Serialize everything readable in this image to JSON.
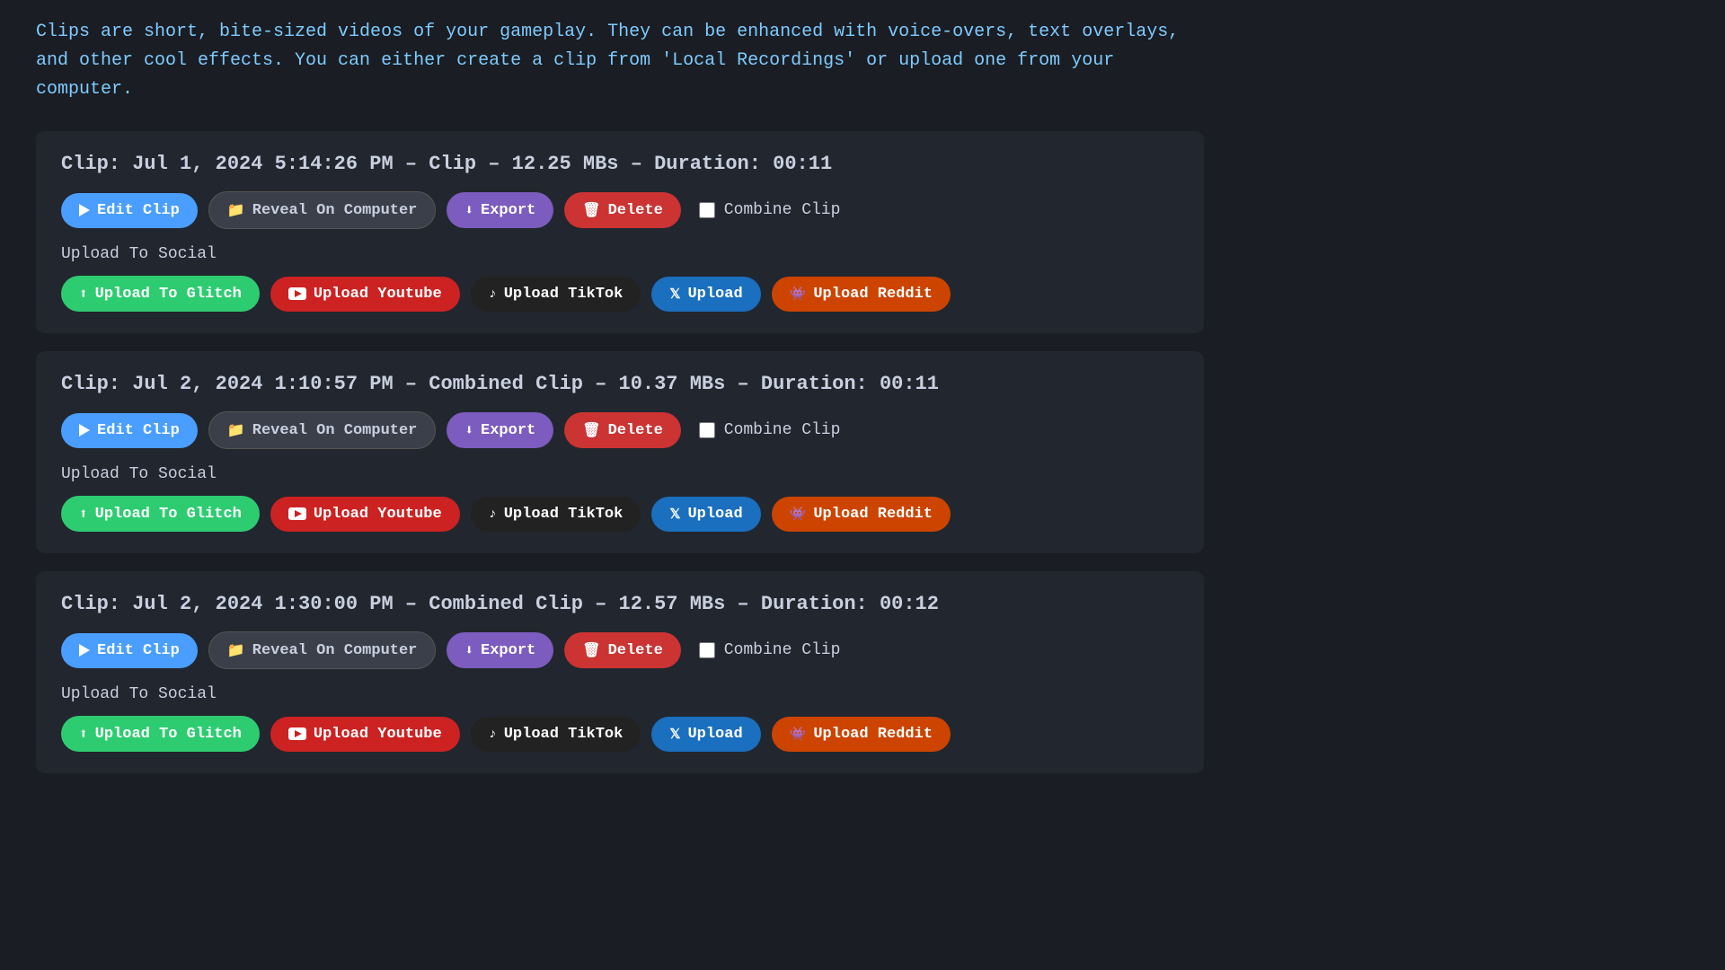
{
  "intro": {
    "text": "Clips are short, bite-sized videos of your gameplay. They can be enhanced with voice-overs, text overlays, and other cool effects. You can either create a clip from 'Local Recordings' or upload one from your computer."
  },
  "clips": [
    {
      "id": "clip1",
      "header": "Clip: Jul 1, 2024 5:14:26 PM – Clip – 12.25 MBs – Duration: 00:11",
      "buttons": {
        "edit": "Edit Clip",
        "reveal": "Reveal On Computer",
        "export": "Export",
        "delete": "Delete",
        "combine_label": "Combine Clip"
      },
      "upload_section_label": "Upload To Social",
      "upload_buttons": {
        "glitch": "Upload To Glitch",
        "youtube": "Upload Youtube",
        "tiktok": "Upload TikTok",
        "x": "Upload",
        "reddit": "Upload Reddit"
      }
    },
    {
      "id": "clip2",
      "header": "Clip: Jul 2, 2024 1:10:57 PM – Combined Clip – 10.37 MBs – Duration: 00:11",
      "buttons": {
        "edit": "Edit Clip",
        "reveal": "Reveal On Computer",
        "export": "Export",
        "delete": "Delete",
        "combine_label": "Combine Clip"
      },
      "upload_section_label": "Upload To Social",
      "upload_buttons": {
        "glitch": "Upload To Glitch",
        "youtube": "Upload Youtube",
        "tiktok": "Upload TikTok",
        "x": "Upload",
        "reddit": "Upload Reddit"
      }
    },
    {
      "id": "clip3",
      "header": "Clip: Jul 2, 2024 1:30:00 PM – Combined Clip – 12.57 MBs – Duration: 00:12",
      "buttons": {
        "edit": "Edit Clip",
        "reveal": "Reveal On Computer",
        "export": "Export",
        "delete": "Delete",
        "combine_label": "Combine Clip"
      },
      "upload_section_label": "Upload To Social",
      "upload_buttons": {
        "glitch": "Upload To Glitch",
        "youtube": "Upload Youtube",
        "tiktok": "Upload TikTok",
        "x": "Upload",
        "reddit": "Upload Reddit"
      }
    }
  ]
}
